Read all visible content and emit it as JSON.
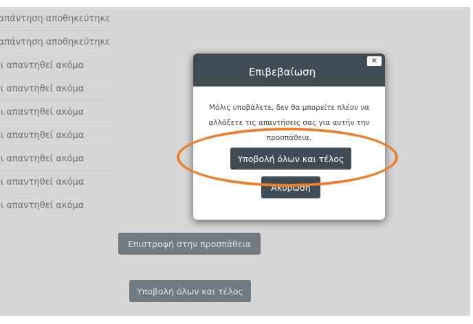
{
  "background": {
    "statuses": [
      "Η απάντηση αποθηκεύτηκε",
      "Η απάντηση αποθηκεύτηκε",
      "Δεν έχει απαντηθεί ακόμα",
      "Δεν έχει απαντηθεί ακόμα",
      "Δεν έχει απαντηθεί ακόμα",
      "Δεν έχει απαντηθεί ακόμα",
      "Δεν έχει απαντηθεί ακόμα",
      "Δεν έχει απαντηθεί ακόμα",
      "Δεν έχει απαντηθεί ακόμα"
    ],
    "return_label": "Επιστροφή στην προσπάθεια",
    "submit_label": "Υποβολή όλων και τέλος"
  },
  "modal": {
    "title": "Επιβεβαίωση",
    "close_symbol": "✕",
    "message": "Μόλις υποβάλετε, δεν θα μπορείτε πλέον να αλλάξετε τις απαντήσεις σας για αυτήν την προσπάθεια.",
    "confirm_label": "Υποβολή όλων και τέλος",
    "cancel_label": "Ακύρωση"
  },
  "colors": {
    "accent_dark": "#3e4b54",
    "highlight": "#ec7e2c",
    "overlay": "#d6d6d6"
  }
}
